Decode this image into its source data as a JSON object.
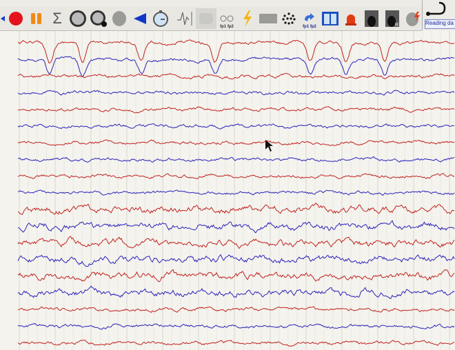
{
  "toolbar": {
    "items": [
      {
        "name": "record-icon"
      },
      {
        "name": "pause-icon"
      },
      {
        "name": "sum-icon"
      },
      {
        "name": "electrode-cap-icon"
      },
      {
        "name": "electrode-cap-alarm-icon"
      },
      {
        "name": "brain-icon"
      },
      {
        "name": "back-triangle-icon"
      },
      {
        "name": "stopwatch-icon"
      },
      {
        "name": "waveform-scale-icon"
      },
      {
        "name": "amplifier-icon"
      },
      {
        "name": "montage-icon",
        "label": "fp1 fp2"
      },
      {
        "name": "lightning-icon"
      },
      {
        "name": "spectrum-icon"
      },
      {
        "name": "electrode-grid-icon"
      },
      {
        "name": "reference-swap-icon",
        "label": "fp1 fp2"
      },
      {
        "name": "book-icon"
      },
      {
        "name": "alarm-light-icon"
      },
      {
        "name": "video-icon"
      },
      {
        "name": "video-r-icon"
      },
      {
        "name": "brain-lightning-icon"
      }
    ]
  },
  "side_panel": {
    "status": "Reading da"
  },
  "eeg": {
    "channel_count": 19,
    "colors": {
      "odd": "#c0221e",
      "even": "#2a22b8",
      "grid": "#d8d6cf"
    }
  }
}
